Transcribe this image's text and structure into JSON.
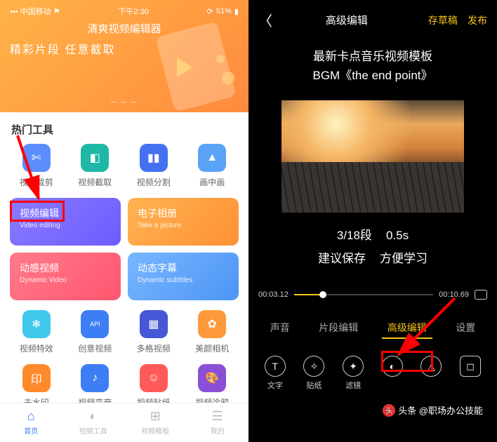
{
  "left": {
    "status": {
      "carrier": "中国移动",
      "signal": "•••",
      "wifi": "⚑",
      "time": "下午2:30",
      "rotate": "⟳",
      "battery_pct": "51%",
      "battery_icon": "▮"
    },
    "hero": {
      "title": "清爽视频编辑器",
      "sub1": "精彩片段",
      "sub2": "任意截取"
    },
    "hot_title": "热门工具",
    "tools": [
      {
        "label": "视频裁剪",
        "color": "ic-blue",
        "icon": "cut-icon",
        "glyph": "✄"
      },
      {
        "label": "视频截取",
        "color": "ic-teal",
        "icon": "capture-icon",
        "glyph": "◧"
      },
      {
        "label": "视频分割",
        "color": "ic-dblue",
        "icon": "split-icon",
        "glyph": "▮▮"
      },
      {
        "label": "画中画",
        "color": "ic-lblue",
        "icon": "pip-icon",
        "glyph": "▲"
      }
    ],
    "cards": [
      {
        "cn": "视频编辑",
        "en": "Video editing",
        "cls": "c-purple"
      },
      {
        "cn": "电子相册",
        "en": "Take a picture",
        "cls": "c-orange"
      },
      {
        "cn": "动感视频",
        "en": "Dynamic Video",
        "cls": "c-red"
      },
      {
        "cn": "动态字幕",
        "en": "Dynamic subtitles",
        "cls": "c-blue"
      }
    ],
    "tools2": [
      {
        "label": "视频特效",
        "color": "ic-cyan",
        "icon": "fx-icon",
        "glyph": "❄"
      },
      {
        "label": "创意视频",
        "color": "ic-nblue",
        "icon": "api-icon",
        "glyph": "API"
      },
      {
        "label": "多格视频",
        "color": "ic-ind",
        "icon": "grid-icon",
        "glyph": "▦"
      },
      {
        "label": "美颜相机",
        "color": "ic-ora",
        "icon": "beauty-icon",
        "glyph": "✿"
      }
    ],
    "tools3": [
      {
        "label": "去水印",
        "color": "ic-orng",
        "icon": "watermark-icon",
        "glyph": "印"
      },
      {
        "label": "视频变音",
        "color": "ic-nblue",
        "icon": "voice-icon",
        "glyph": "♪"
      },
      {
        "label": "视频贴纸",
        "color": "ic-red",
        "icon": "sticker-icon",
        "glyph": "☺"
      },
      {
        "label": "视频涂鸦",
        "color": "ic-pur",
        "icon": "doodle-icon",
        "glyph": "🎨"
      }
    ],
    "nav": [
      {
        "label": "首页",
        "icon": "home-icon",
        "glyph": "⌂",
        "active": true
      },
      {
        "label": "视频工具",
        "icon": "tools-nav-icon",
        "glyph": "◐",
        "active": false
      },
      {
        "label": "视频模板",
        "icon": "template-icon",
        "glyph": "⊞",
        "active": false
      },
      {
        "label": "我的",
        "icon": "profile-icon",
        "glyph": "☰",
        "active": false
      }
    ]
  },
  "right": {
    "top": {
      "back": "〈",
      "title": "高级编辑",
      "draft": "存草稿",
      "publish": "发布"
    },
    "headline1": "最新卡点音乐视频模板",
    "headline2": "BGM《the end point》",
    "info1_a": "3/18段",
    "info1_b": "0.5s",
    "info2_a": "建议保存",
    "info2_b": "方便学习",
    "time_cur": "00:03.12",
    "time_total": "00:10.69",
    "tabs": [
      {
        "label": "声音",
        "active": false
      },
      {
        "label": "片段编辑",
        "active": false
      },
      {
        "label": "高级编辑",
        "active": true
      },
      {
        "label": "设置",
        "active": false
      }
    ],
    "tools": [
      {
        "label": "文字",
        "icon": "text-icon",
        "glyph": "T"
      },
      {
        "label": "贴纸",
        "icon": "sticker-tool-icon",
        "glyph": "✧"
      },
      {
        "label": "滤镜",
        "icon": "filter-icon",
        "glyph": "✦"
      },
      {
        "label": "",
        "icon": "adjust-icon",
        "glyph": "◐"
      },
      {
        "label": "",
        "icon": "effect-icon",
        "glyph": "△"
      },
      {
        "label": "",
        "icon": "crop-icon",
        "glyph": "◻"
      }
    ],
    "watermark": "头条 @职场办公技能"
  }
}
